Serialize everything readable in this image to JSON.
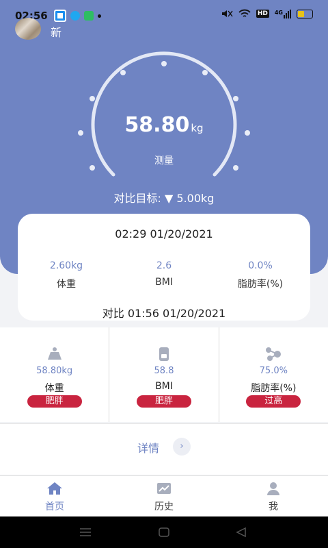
{
  "status_bar": {
    "time": "02:56",
    "network": "4G"
  },
  "header": {
    "new_label": "新"
  },
  "gauge": {
    "value": "58.80",
    "unit": "kg",
    "label": "测量"
  },
  "target": {
    "text": "对比目标: ▼ 5.00kg"
  },
  "card": {
    "datetime": "02:29 01/20/2021",
    "stats": [
      {
        "value": "2.60kg",
        "label": "体重"
      },
      {
        "value": "2.6",
        "label": "BMI"
      },
      {
        "value": "0.0%",
        "label": "脂肪率(%)"
      }
    ],
    "compare": "对比 01:56 01/20/2021"
  },
  "metrics": [
    {
      "icon": "weight-icon",
      "value": "58.80kg",
      "label": "体重",
      "badge": "肥胖"
    },
    {
      "icon": "bmi-icon",
      "value": "58.8",
      "label": "BMI",
      "badge": "肥胖"
    },
    {
      "icon": "molecule-icon",
      "value": "75.0%",
      "label": "脂肪率(%)",
      "badge": "过高"
    }
  ],
  "details": {
    "label": "详情",
    "arrow": "›"
  },
  "tabs": [
    {
      "label": "首页",
      "icon": "home-icon",
      "active": true
    },
    {
      "label": "历史",
      "icon": "chart-icon",
      "active": false
    },
    {
      "label": "我",
      "icon": "user-icon",
      "active": false
    }
  ],
  "colors": {
    "primary": "#6f84c3",
    "badge": "#c9243f",
    "inactive": "#666666"
  }
}
